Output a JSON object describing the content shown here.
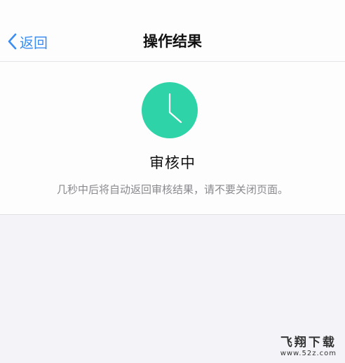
{
  "navbar": {
    "back_label": "返回",
    "title": "操作结果"
  },
  "result": {
    "icon": "clock-icon",
    "icon_color": "#2ed3a8",
    "status_title": "审核中",
    "description": "几秒中后将自动返回审核结果，请不要关闭页面。"
  },
  "watermark": {
    "logo_text": "飞翔下载",
    "url": "www.52z.com"
  },
  "colors": {
    "accent": "#3d8ef0",
    "background": "#f4f3f8"
  }
}
